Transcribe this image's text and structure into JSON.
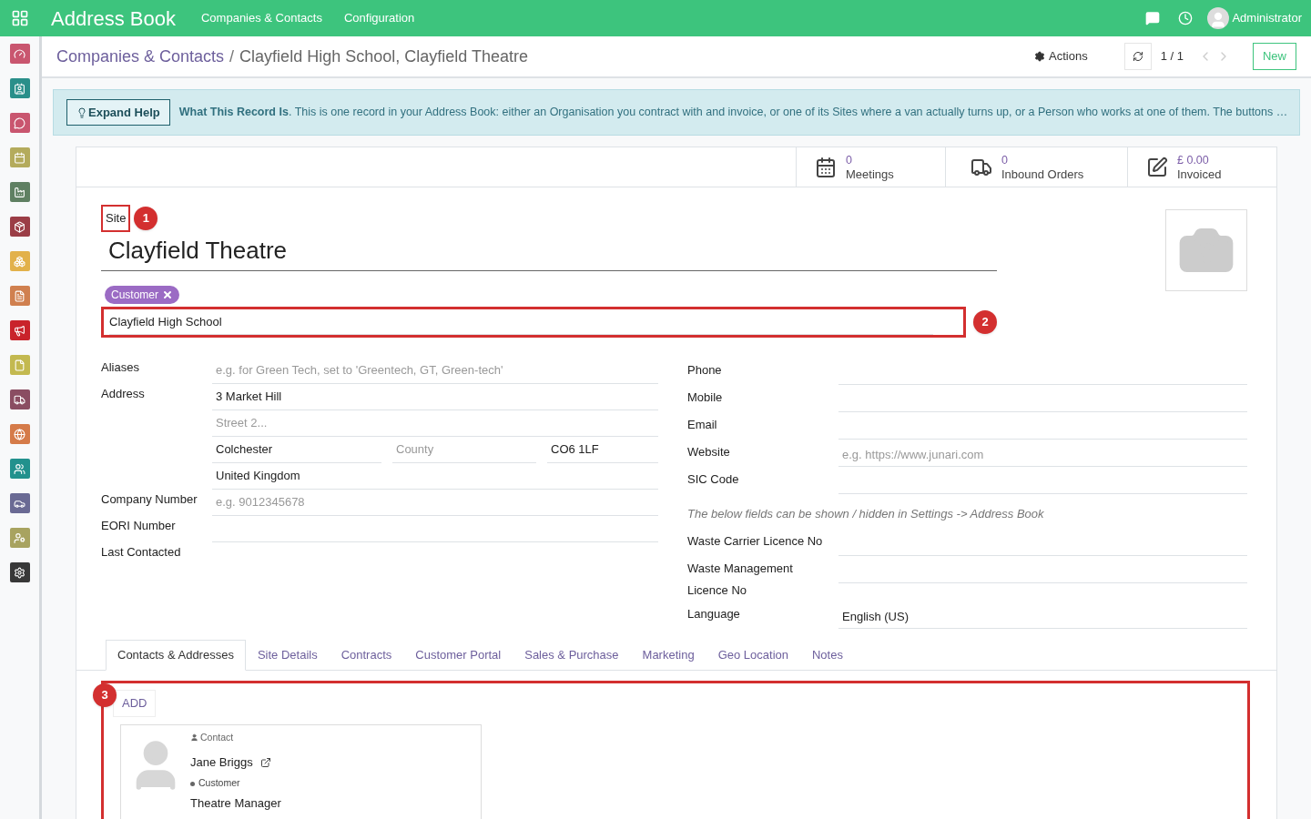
{
  "topbar": {
    "app_title": "Address Book",
    "menus": [
      "Companies & Contacts",
      "Configuration"
    ],
    "user": "Administrator"
  },
  "sidebar": {
    "apps": [
      {
        "color": "#c9566f"
      },
      {
        "color": "#2a8f8a"
      },
      {
        "color": "#c9566f"
      },
      {
        "color": "#b4ab5c"
      },
      {
        "color": "#5f8062"
      },
      {
        "color": "#9b3d46"
      },
      {
        "color": "#e2b14a"
      },
      {
        "color": "#d0804f"
      },
      {
        "color": "#c9232b"
      },
      {
        "color": "#c3b950"
      },
      {
        "color": "#8a4d62"
      },
      {
        "color": "#d57b49"
      },
      {
        "color": "#22918d"
      },
      {
        "color": "#6a6a94"
      },
      {
        "color": "#a8a360"
      },
      {
        "color": "#383838"
      }
    ]
  },
  "breadcrumb": {
    "parent": "Companies & Contacts",
    "separator": "/",
    "current": "Clayfield High School, Clayfield Theatre"
  },
  "control_panel": {
    "actions": "Actions",
    "pager": "1 / 1",
    "new_button": "New"
  },
  "help": {
    "button": "Expand Help",
    "text": "**What This Record Is**. This is one record in your Address Book: either an Organisation you contract with and invoice, or one of its Sites where a van actually turns up, or a Person who works at one of them. The buttons …"
  },
  "stat_buttons": [
    {
      "value": "0",
      "label": "Meetings"
    },
    {
      "value": "0",
      "label": "Inbound Orders"
    },
    {
      "value": "£ 0.00",
      "label": "Invoiced"
    }
  ],
  "record": {
    "type_label": "Site",
    "name": "Clayfield Theatre",
    "tags": [
      {
        "label": "Customer",
        "color": "#9b6bc4"
      }
    ],
    "parent": "Clayfield High School"
  },
  "callouts": [
    "1",
    "2",
    "3"
  ],
  "left_fields": [
    {
      "label": "Aliases",
      "rows": [
        [
          {
            "placeholder": "e.g. for Green Tech, set to 'Greentech, GT, Green-tech'"
          }
        ]
      ]
    },
    {
      "label": "Address",
      "rows": [
        [
          {
            "value": "3 Market Hill"
          }
        ],
        [
          {
            "placeholder": "Street 2..."
          }
        ],
        [
          {
            "value": "Colchester"
          },
          {
            "placeholder": "County"
          },
          {
            "value": "CO6 1LF"
          }
        ],
        [
          {
            "value": "United Kingdom"
          }
        ]
      ]
    },
    {
      "label": "Company Number",
      "rows": [
        [
          {
            "placeholder": "e.g. 9012345678"
          }
        ]
      ]
    },
    {
      "label": "EORI Number",
      "rows": [
        [
          {}
        ]
      ]
    },
    {
      "label": "Last Contacted"
    }
  ],
  "right_fields": [
    {
      "kind": "field",
      "label": "Phone"
    },
    {
      "kind": "field",
      "label": "Mobile"
    },
    {
      "kind": "field",
      "label": "Email"
    },
    {
      "kind": "field",
      "label": "Website",
      "placeholder": "e.g. https://www.junari.com"
    },
    {
      "kind": "field",
      "label": "SIC Code"
    },
    {
      "kind": "note",
      "text": "The below fields can be shown / hidden in Settings -> Address Book"
    },
    {
      "kind": "field",
      "label": "Waste Carrier Licence No"
    },
    {
      "kind": "field",
      "label": "Waste Management Licence No"
    },
    {
      "kind": "field",
      "label": "Language",
      "value": "English (US)"
    }
  ],
  "tabs": [
    {
      "label": "Contacts & Addresses",
      "selected": true
    },
    {
      "label": "Site Details",
      "selected": false
    },
    {
      "label": "Contracts",
      "selected": false
    },
    {
      "label": "Customer Portal",
      "selected": false
    },
    {
      "label": "Sales & Purchase",
      "selected": false
    },
    {
      "label": "Marketing",
      "selected": false
    },
    {
      "label": "Geo Location",
      "selected": false
    },
    {
      "label": "Notes",
      "selected": false
    }
  ],
  "contacts": {
    "add_button": "ADD",
    "cards": [
      {
        "type": "Contact",
        "name": "Jane Briggs",
        "tag": "Customer",
        "function": "Theatre Manager"
      }
    ]
  }
}
